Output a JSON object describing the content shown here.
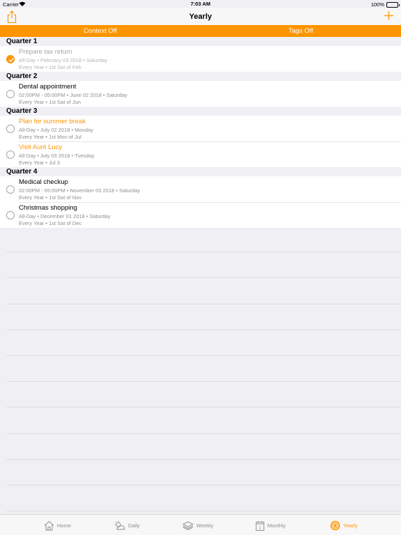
{
  "status": {
    "carrier": "Carrier",
    "time": "7:03 AM",
    "battery": "100%"
  },
  "nav": {
    "title": "Yearly",
    "share_icon": "share-icon",
    "add_icon": "plus-icon"
  },
  "filters": {
    "context": "Context Off",
    "tags": "Tags Off"
  },
  "accent_color": "#ff9500",
  "sections": [
    {
      "header": "Quarter 1",
      "items": [
        {
          "title": "Prepare tax return",
          "detail": "All-Day • February 03 2018 • Saturday",
          "repeat": "Every Year • 1st Sat of Feb",
          "completed": true,
          "style": "muted"
        }
      ]
    },
    {
      "header": "Quarter 2",
      "items": [
        {
          "title": "Dental appointment",
          "detail": "02:00PM - 05:00PM • June 02 2018 • Saturday",
          "repeat": "Every Year • 1st Sat of Jun",
          "completed": false,
          "style": "normal"
        }
      ]
    },
    {
      "header": "Quarter 3",
      "items": [
        {
          "title": "Plan for summer break",
          "detail": "All-Day • July 02 2018 • Monday",
          "repeat": "Every Year • 1st Mon of Jul",
          "completed": false,
          "style": "orange"
        },
        {
          "title": "Visit Aunt Lucy",
          "detail": "All-Day • July 03 2018 • Tuesday",
          "repeat": "Every Year • Jul 3",
          "completed": false,
          "style": "orange"
        }
      ]
    },
    {
      "header": "Quarter 4",
      "items": [
        {
          "title": "Medical checkup",
          "detail": "02:00PM - 05:00PM • November 03 2018 • Saturday",
          "repeat": "Every Year • 1st Sat of Nov",
          "completed": false,
          "style": "normal"
        },
        {
          "title": "Christmas shopping",
          "detail": "All-Day • December 01 2018 • Saturday",
          "repeat": "Every Year • 1st Sat of Dec",
          "completed": false,
          "style": "normal"
        }
      ]
    }
  ],
  "tabs": [
    {
      "label": "Home",
      "icon": "home-icon",
      "active": false
    },
    {
      "label": "Daily",
      "icon": "daily-icon",
      "active": false
    },
    {
      "label": "Weekly",
      "icon": "weekly-icon",
      "active": false
    },
    {
      "label": "Monthly",
      "icon": "monthly-icon",
      "active": false
    },
    {
      "label": "Yearly",
      "icon": "yearly-icon",
      "active": true
    }
  ]
}
